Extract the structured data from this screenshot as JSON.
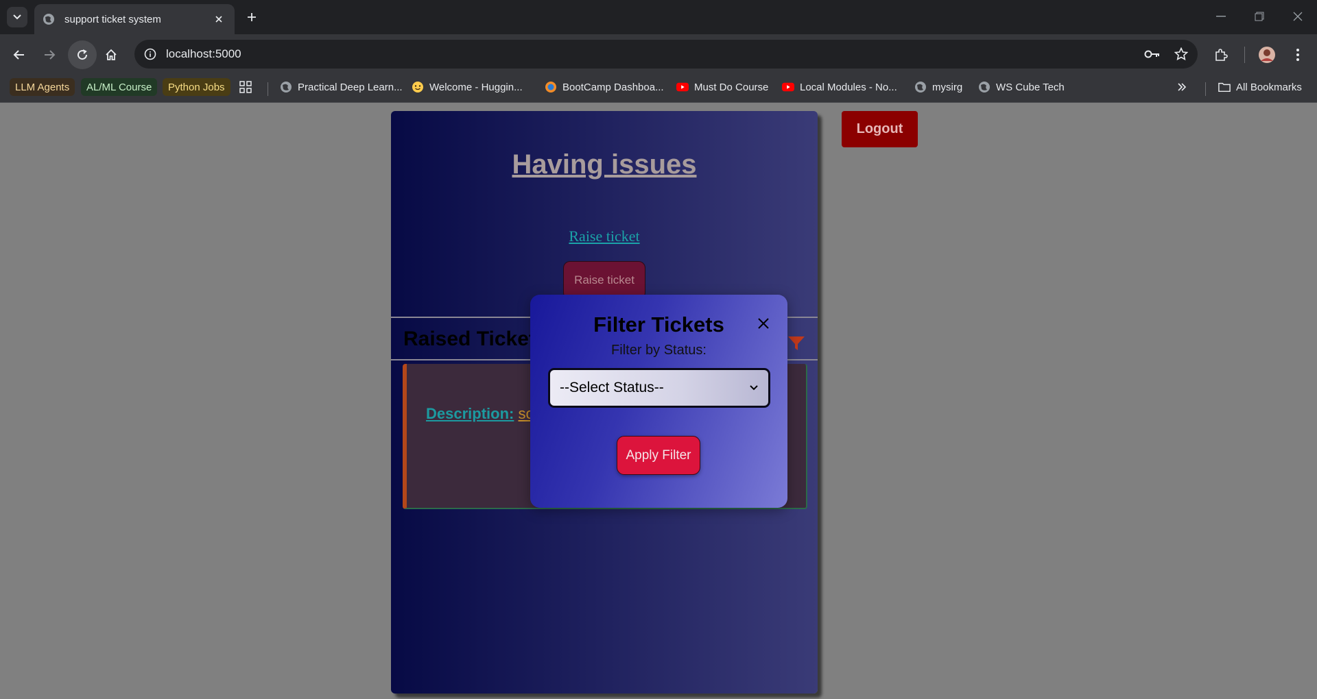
{
  "browser": {
    "tab_title": "support ticket system",
    "url": "localhost:5000",
    "bookmarks": [
      {
        "label": "LLM Agents",
        "chip_color": "#3b2e1f",
        "text_color": "#f6d89b"
      },
      {
        "label": "AL/ML Course",
        "chip_color": "#213a26",
        "text_color": "#c7f0c7"
      },
      {
        "label": "Python Jobs",
        "chip_color": "#4a3d14",
        "text_color": "#f7dd86"
      },
      {
        "label": "Practical Deep Learn..."
      },
      {
        "label": "Welcome - Huggin..."
      },
      {
        "label": "BootCamp Dashboa..."
      },
      {
        "label": "Must Do Course"
      },
      {
        "label": "Local Modules - No..."
      },
      {
        "label": "mysirg"
      },
      {
        "label": "WS Cube Tech"
      }
    ],
    "all_bookmarks_label": "All Bookmarks"
  },
  "page": {
    "heading": "Having issues",
    "raise_link": "Raise ticket",
    "raise_button": "Raise ticket",
    "raised_tickets_title": "Raised Tickets",
    "logout_button": "Logout",
    "ticket": {
      "description_label": "Description:",
      "description_value": "so"
    }
  },
  "modal": {
    "title": "Filter Tickets",
    "label": "Filter by Status:",
    "select_value": "--Select Status--",
    "apply_button": "Apply Filter"
  },
  "colors": {
    "logout": "#8b0000",
    "apply": "#dc143c",
    "filter_icon": "#c0391b"
  }
}
